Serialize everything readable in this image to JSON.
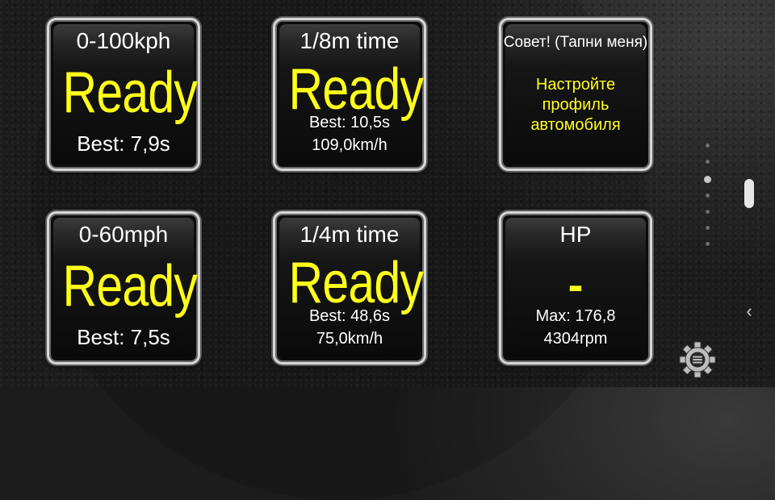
{
  "tiles": {
    "t0_100kph": {
      "title": "0-100kph",
      "value": "Ready",
      "best": "Best: 7,9s"
    },
    "t1_8m": {
      "title": "1/8m time",
      "value": "Ready",
      "best": "Best: 10,5s",
      "speed": "109,0km/h"
    },
    "tip": {
      "title": "Совет! (Тапни меня)",
      "line1": "Настройте",
      "line2": "профиль",
      "line3": "автомобиля"
    },
    "t0_60mph": {
      "title": "0-60mph",
      "value": "Ready",
      "best": "Best: 7,5s"
    },
    "t1_4m": {
      "title": "1/4m time",
      "value": "Ready",
      "best": "Best: 48,6s",
      "speed": "75,0km/h"
    },
    "hp": {
      "title": "HP",
      "value": "-",
      "max": "Max: 176,8",
      "rpm": "4304rpm"
    }
  },
  "pager": {
    "pages": 7,
    "active_page": 2
  },
  "icons": {
    "settings": "gear-icon",
    "back": "chevron-left-icon"
  },
  "colors": {
    "accent": "#ffff1a",
    "text": "#ffffff",
    "tile_border": "#d6d6d6"
  }
}
